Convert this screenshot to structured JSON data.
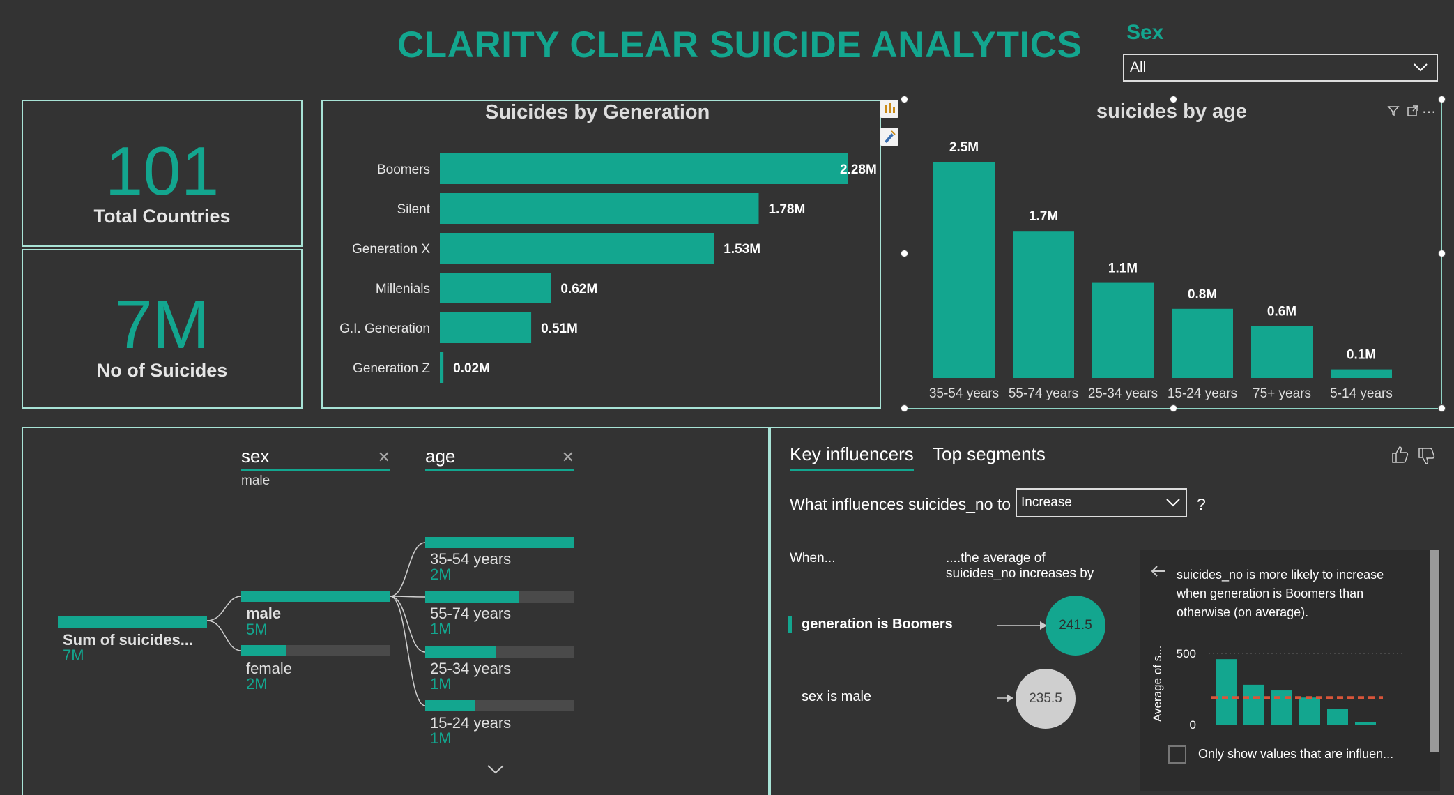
{
  "header": {
    "title": "CLARITY CLEAR SUICIDE ANALYTICS"
  },
  "slicer": {
    "label": "Sex",
    "value": "All"
  },
  "kpis": [
    {
      "value": "101",
      "label": "Total Countries"
    },
    {
      "value": "7M",
      "label": "No of Suicides"
    }
  ],
  "generation_chart": {
    "title": "Suicides by Generation"
  },
  "age_chart": {
    "title": "suicides by age"
  },
  "chart_data": [
    {
      "type": "bar",
      "orientation": "horizontal",
      "title": "Suicides by Generation",
      "categories": [
        "Boomers",
        "Silent",
        "Generation X",
        "Millenials",
        "G.I. Generation",
        "Generation Z"
      ],
      "values": [
        2.28,
        1.78,
        1.53,
        0.62,
        0.51,
        0.02
      ],
      "labels": [
        "2.28M",
        "1.78M",
        "1.53M",
        "0.62M",
        "0.51M",
        "0.02M"
      ],
      "color": "#13a68f"
    },
    {
      "type": "bar",
      "orientation": "vertical",
      "title": "suicides by age",
      "categories": [
        "35-54 years",
        "55-74 years",
        "25-34 years",
        "15-24 years",
        "75+ years",
        "5-14 years"
      ],
      "values": [
        2.5,
        1.7,
        1.1,
        0.8,
        0.6,
        0.1
      ],
      "labels": [
        "2.5M",
        "1.7M",
        "1.1M",
        "0.8M",
        "0.6M",
        "0.1M"
      ],
      "color": "#13a68f"
    }
  ],
  "decomp_tree": {
    "headers": [
      {
        "name": "sex",
        "sub": "male"
      },
      {
        "name": "age",
        "sub": ""
      }
    ],
    "root": {
      "label": "Sum of suicides...",
      "value": "7M"
    },
    "sex_nodes": [
      {
        "label": "male",
        "value": "5M",
        "fill": 1.0
      },
      {
        "label": "female",
        "value": "2M",
        "fill": 0.3
      }
    ],
    "age_nodes": [
      {
        "label": "35-54 years",
        "value": "2M",
        "fill": 1.0
      },
      {
        "label": "55-74 years",
        "value": "1M",
        "fill": 0.63
      },
      {
        "label": "25-34 years",
        "value": "1M",
        "fill": 0.47
      },
      {
        "label": "15-24 years",
        "value": "1M",
        "fill": 0.33
      }
    ]
  },
  "key_influencers": {
    "tabs": [
      "Key influencers",
      "Top segments"
    ],
    "question_prefix": "What influences suicides_no to",
    "dropdown_value": "Increase",
    "question_suffix": "?",
    "col_when": "When...",
    "col_avg": "....the average of suicides_no increases by",
    "influencers": [
      {
        "label": "generation is Boomers",
        "value": "241.5",
        "selected": true
      },
      {
        "label": "sex is male",
        "value": "235.5",
        "selected": false
      }
    ],
    "detail": {
      "text": "suicides_no is more likely to increase when generation is Boomers than otherwise (on average).",
      "y_label": "Average of s...",
      "y_ticks": [
        "500",
        "0"
      ],
      "bar_values": [
        460,
        280,
        240,
        190,
        110,
        15
      ],
      "reference_line": 190,
      "checkbox_label": "Only show values that are influen..."
    }
  },
  "colors": {
    "accent": "#13a68f",
    "background": "#333333",
    "border": "#a8e3d6",
    "reference": "#d9553a"
  }
}
